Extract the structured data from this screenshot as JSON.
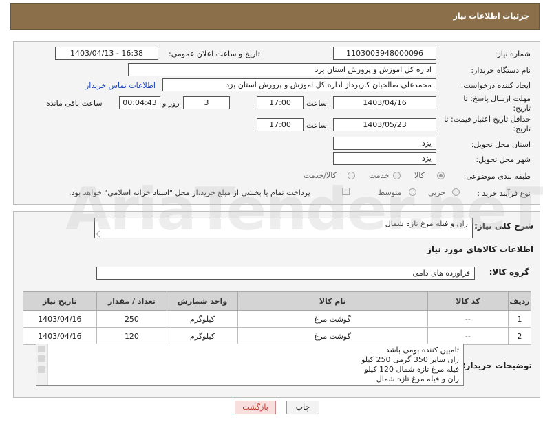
{
  "header": {
    "title": "جزئیات اطلاعات نیاز"
  },
  "details": {
    "need_number_label": "شماره نیاز:",
    "need_number": "1103003948000096",
    "announce_label": "تاریخ و ساعت اعلان عمومی:",
    "announce_value": "1403/04/13 - 16:38",
    "buyer_label": "نام دستگاه خریدار:",
    "buyer_value": "اداره کل اموزش و پرورش استان یزد",
    "creator_label": "ایجاد کننده درخواست:",
    "creator_value": "محمدعلي صالحيان کارپرداز اداره کل اموزش و پرورش استان يزد",
    "contact_link": "اطلاعات تماس خریدار",
    "deadline_label": "مهلت ارسال پاسخ: تا تاریخ:",
    "deadline_date": "1403/04/16",
    "time_label": "ساعت",
    "deadline_time": "17:00",
    "days_value": "3",
    "days_label": "روز و",
    "remaining_value": "00:04:43",
    "remaining_label": "ساعت باقی مانده",
    "validity_label": "حداقل تاریخ اعتبار قیمت: تا تاریخ:",
    "validity_date": "1403/05/23",
    "validity_time": "17:00",
    "province_label": "استان محل تحویل:",
    "province_value": "یزد",
    "city_label": "شهر محل تحویل:",
    "city_value": "یزد",
    "category_label": "طبقه بندی موضوعی:",
    "category_options": [
      "کالا",
      "خدمت",
      "کالا/خدمت"
    ],
    "category_selected": "کالا",
    "process_label": "نوع فرآیند خرید :",
    "process_options": [
      "جزیی",
      "متوسط"
    ],
    "process_note": "پرداخت تمام یا بخشی از مبلغ خرید،از محل \"اسناد خزانه اسلامی\" خواهد بود."
  },
  "description": {
    "label": "شرح کلی نیاز:",
    "value": "ران و فیله مرغ تازه شمال"
  },
  "goods": {
    "section_title": "اطلاعات کالاهای مورد نیاز",
    "group_label": "گروه کالا:",
    "group_value": "فراورده های دامی",
    "columns": [
      "ردیف",
      "کد کالا",
      "نام کالا",
      "واحد شمارش",
      "تعداد / مقدار",
      "تاریخ نیاز"
    ],
    "rows": [
      {
        "row": "1",
        "code": "--",
        "name": "گوشت مرغ",
        "unit": "کیلوگرم",
        "qty": "250",
        "date": "1403/04/16"
      },
      {
        "row": "2",
        "code": "--",
        "name": "گوشت مرغ",
        "unit": "کیلوگرم",
        "qty": "120",
        "date": "1403/04/16"
      }
    ]
  },
  "buyer_notes": {
    "label": "توضیحات خریدار:",
    "lines": [
      "تامیین کننده بومی باشد",
      "ران سایز 350 گرمی 250 کیلو",
      "فیله مرغ تازه شمال 120 کیلو",
      "ران و فیله مرغ تازه شمال"
    ]
  },
  "actions": {
    "print_label": "چاپ",
    "back_label": "بازگشت"
  },
  "watermark": "AriaTender.neT"
}
